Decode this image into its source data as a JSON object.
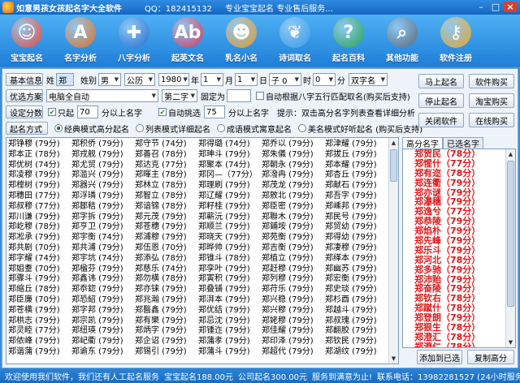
{
  "window": {
    "title": "如意男孩女孩起名字大全软件",
    "qq": "QQ：182415132",
    "slogan": "专业宝宝起名  专业售后服务...",
    "minimize": "–",
    "maximize": "□",
    "close": "×"
  },
  "toolbar": [
    {
      "label": "宝宝起名",
      "icon": "baby-girl-icon",
      "glyph": "☺",
      "color": "#e84a3a"
    },
    {
      "label": "名字分析",
      "icon": "letter-a-icon",
      "glyph": "A",
      "color": "#e2701c"
    },
    {
      "label": "八字分析",
      "icon": "compass-icon",
      "glyph": "✚",
      "color": "#2a6fd0"
    },
    {
      "label": "起英文名",
      "icon": "abc-ball-icon",
      "glyph": "Ab",
      "color": "#d8385a"
    },
    {
      "label": "乳名小名",
      "icon": "boy-face-icon",
      "glyph": "☻",
      "color": "#e89a2a"
    },
    {
      "label": "诗词取名",
      "icon": "bird-icon",
      "glyph": "❦",
      "color": "#3aa0e8"
    },
    {
      "label": "起名百科",
      "icon": "question-icon",
      "glyph": "?",
      "color": "#2aa64a"
    },
    {
      "label": "其他功能",
      "icon": "magnifier-icon",
      "glyph": "⌕",
      "color": "#5a6a7a"
    },
    {
      "label": "软件注册",
      "icon": "key-icon",
      "glyph": "⚷",
      "color": "#e8a82a"
    }
  ],
  "form": {
    "basic_info": "基本信息",
    "surname_label": "姓",
    "surname_value": "郑",
    "gender_label": "姓别",
    "gender_value": "男",
    "calendar_value": "公历",
    "year_value": "1980",
    "year_label": "年",
    "month_value": "1",
    "month_label": "月",
    "day_value": "1",
    "day_label": "日",
    "hour_value": "子 0",
    "hour_label": "时",
    "minute_value": "0",
    "minute_label": "分",
    "word_count_value": "双字名",
    "preferred_plan": "优选方案",
    "plan_value": "电脑全自动",
    "position_value": "第二字",
    "fixed_label": "固定为",
    "fixed_value": "",
    "auto_bazi_label": "自动根据八字五行匹配取名(购买后支持)",
    "set_score": "设定分数",
    "only_start_label": "只起",
    "only_score_value": "70",
    "only_suffix": "分以上名字",
    "auto_pick_label": "自动挑选",
    "auto_score_value": "75",
    "auto_suffix": "分以上名字",
    "tip": "提示：双击高分名字列表查看详细分析",
    "naming_mode": "起名方式",
    "modes": [
      {
        "label": "经典模式高分起名",
        "on": true
      },
      {
        "label": "列表模式详细起名",
        "on": false
      },
      {
        "label": "成语模式寓意起名",
        "on": false
      },
      {
        "label": "美名模式好听起名 (购买后支持)",
        "on": false
      }
    ]
  },
  "buttons": {
    "start": "马上起名",
    "buy": "软件购买",
    "stop": "停止起名",
    "taobao": "淘宝购买",
    "close_soft": "关闭软件",
    "online": "在线购买",
    "add": "添加到已选",
    "copy": "复制高分"
  },
  "tabs": [
    "高分名字",
    "已选名字"
  ],
  "names": [
    [
      "郑铮穆 (79分)",
      "郑本正 (78分)",
      "郑优树 (74分)",
      "郑凌穆 (79分)",
      "郑樘树 (79分)",
      "郑穗田 (77分)",
      "郑叔穆 (77分)",
      "郑川谦 (79分)",
      "郑屹穆 (78分)",
      "郑凇承 (79分)",
      "郑共剧 (70分)",
      "郑字耀 (74分)",
      "郑姐耋 (70分)",
      "郑骤斗 (79分)",
      "郑缩丘 (78分)",
      "郑臣廉 (70分)",
      "郑苍横 (79分)",
      "郑栱志 (79分)",
      "郑灵睦 (77分)",
      "郑侬峰 (79分)",
      "郑谐蒲 (79分)"
    ],
    [
      "郑积侨 (79分)",
      "郑戎舰 (79分)",
      "郑尤贸 (79分)",
      "郑滥兴 (79分)",
      "郑器兴 (79分)",
      "郑浮璘 (79分)",
      "郑鄒秸 (79分)",
      "郑字拆 (79分)",
      "郑亨卫 (79分)",
      "郑宇衡 (74分)",
      "郑共浦 (79分)",
      "郑宇坑 (74分)",
      "郑楹芬 (79分)",
      "郑鑫讳 (79分)",
      "郑忝鍃 (79分)",
      "郑恐紹 (79分)",
      "郑字邦 (79分)",
      "郑宗凯 (79分)",
      "郑纽瑛 (79分)",
      "郑屺衢 (79分)",
      "郑谕东 (79分)"
    ],
    [
      "郑守节 (74分)",
      "郑善召 (78分)",
      "郑达克 (77分)",
      "郑暉主 (78分)",
      "郑林立 (78分)",
      "郑智立 (78分)",
      "郑谙锦 (78分)",
      "郑元茂 (79分)",
      "郑苍穗 (79分)",
      "郑浦穆 (79分)",
      "郑伍恩 (70分)",
      "郑添弘 (78分)",
      "郑慈乐 (74分)",
      "郑勿横 (78分)",
      "郑亦铼 (79分)",
      "郑兆瀚 (79分)",
      "郑醫鑫 (79分)",
      "郑有樂 (79分)",
      "郑炳字 (79分)",
      "郑企诏 (79分)",
      "郑锡引 (79分)"
    ],
    [
      "郑得璐 (74分)",
      "郑珅斗 (79分)",
      "郑聚本 (74分)",
      "郑冈—（77分）",
      "郑理刷 (79分)",
      "郑辽耀 (79分)",
      "郑籽桂 (79分)",
      "郑蕲沅 (79分)",
      "郑顺兰 (79分)",
      "郑晓天 (79分)",
      "郑晔帅 (79分)",
      "郑锥斗 (78分)",
      "郑孪叶 (79分)",
      "郑寅积 (79分)",
      "郑叠铺 (79分)",
      "郑湃本 (79分)",
      "郑优结 (79分)",
      "郑忌沈 (79分)",
      "郑锺迮 (79分)",
      "郑蒲孝 (79分)",
      "郑蒲斗 (79分)"
    ],
    [
      "郑乔以 (79分)",
      "郑朱儀 (79分)",
      "郑朝永 (79分)",
      "郑潑冉 (79分)",
      "郑茂龙 (79分)",
      "郑敫北 (79分)",
      "郑臣密 (79分)",
      "郑聯木 (79分)",
      "郑鋪垵 (79分)",
      "郑苑衡 (79分)",
      "郑吉衡 (79分)",
      "郑植立 (79分)",
      "郑赶穆 (79分)",
      "郑列穆 (79分)",
      "郑苻乐 (79分)",
      "郑兴稳 (79分)",
      "郑兴穆 (79分)",
      "郑姥穆 (79分)",
      "郑佳耀 (79分)",
      "郑印泽 (79分)",
      "郑超代 (79分)"
    ],
    [
      "郑津耀 (79分)",
      "郑拔丘 (79分)",
      "郑本耀 (79分)",
      "郑杏丘 (79分)",
      "郑献石 (79分)",
      "郑吾字 (79分)",
      "郑嵊邦 (79分)",
      "郑民号 (79分)",
      "郑贸幼 (79分)",
      "郑得幼 (79分)",
      "郑凄穆 (79分)",
      "郑缂本 (79分)",
      "郑幽苏 (79分)",
      "郑宏衡 (79分)",
      "郑史琰 (79分)",
      "郑杉酉 (79分)",
      "郑越斗 (79分)",
      "郑叔瑰 (79分)",
      "郑翻胶 (79分)",
      "郑钦民 (79分)",
      "郑湖纹 (79分)"
    ]
  ],
  "high_scores": [
    "郑贺民（78分）",
    "郑惺什（77分）",
    "郑有迩（78分）",
    "郑连衢（79分）",
    "郑亦谜（79分）",
    "郑瀑穗（79分）",
    "郑逸兮（77分）",
    "郑恭陵（79分）",
    "郑焰朴（79分）",
    "郑先峰（79分）",
    "郑乐斗（79分）",
    "郑河北（78分）",
    "郑多驰（79分）",
    "郑沛贻（79分）",
    "郑奋陵（79分）",
    "郑钦右（78分）",
    "郑蹴什（78分）",
    "郑登朗（79分）",
    "郑狠生（78分）",
    "郑澄汇（78分）",
    "郑澄仁（78分）"
  ],
  "status": {
    "welcome": "欢迎使用我们软件，我们还有人工起名服务",
    "baby_price": "宝宝起名188.00元",
    "company_price": "公司起名300.00元",
    "satisfaction": "服务到满意为止!",
    "phone": "联系电话：13982281527 (24小时服务)"
  }
}
